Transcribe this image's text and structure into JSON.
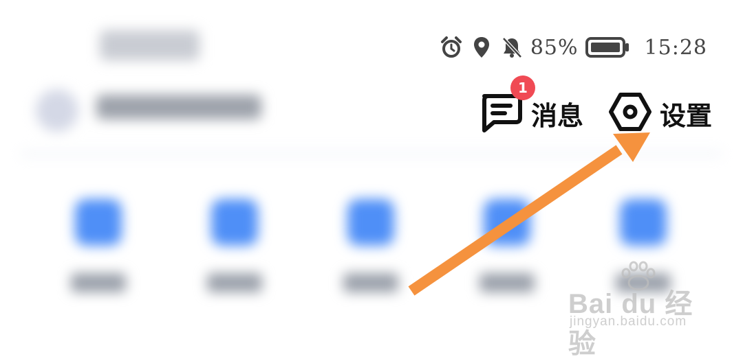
{
  "status_bar": {
    "icons": [
      "alarm-icon",
      "location-icon",
      "bell-muted-icon",
      "battery-icon"
    ],
    "battery_percent": "85%",
    "time": "15:28"
  },
  "header": {
    "messages": {
      "label": "消息",
      "badge_count": "1"
    },
    "settings": {
      "label": "设置"
    }
  },
  "annotation": {
    "arrow_color": "#f5923e"
  },
  "watermark": {
    "brand": "Bai du 经验",
    "url": "jingyan.baidu.com"
  },
  "colors": {
    "badge": "#f04a54",
    "accent": "#4f8ff7"
  }
}
